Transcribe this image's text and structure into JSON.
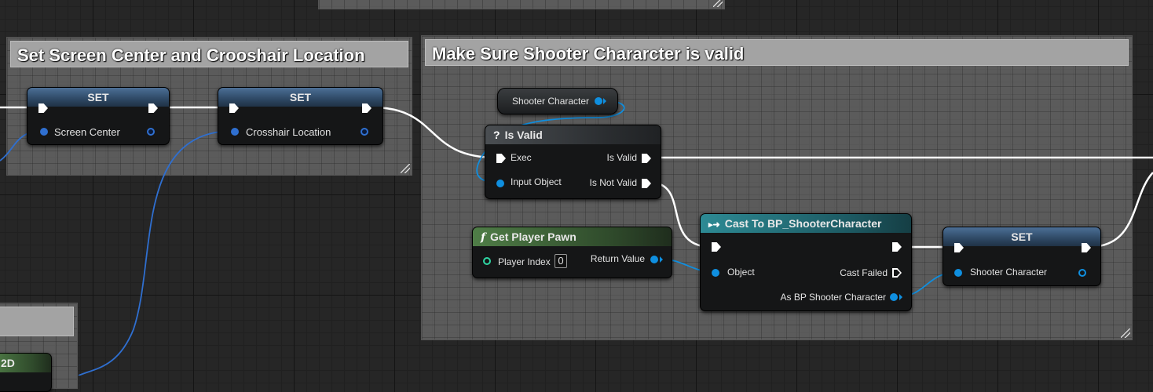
{
  "comments": {
    "top_partial": {
      "title": ""
    },
    "left": {
      "title": "Set Screen Center and Crooshair Location"
    },
    "right": {
      "title": "Make Sure Shooter Chararcter is valid"
    },
    "bottom_left": {
      "title": ""
    }
  },
  "nodes": {
    "set_screen_center": {
      "title": "SET",
      "var_label": "Screen Center"
    },
    "set_crosshair": {
      "title": "SET",
      "var_label": "Crosshair Location"
    },
    "shooter_character_getter": {
      "label": "Shooter Character"
    },
    "is_valid": {
      "title": "Is Valid",
      "exec_label": "Exec",
      "input_label": "Input Object",
      "is_valid_label": "Is Valid",
      "is_not_valid_label": "Is Not Valid"
    },
    "get_player_pawn": {
      "title": "Get Player Pawn",
      "player_index_label": "Player Index",
      "player_index_value": "0",
      "return_label": "Return Value"
    },
    "cast": {
      "title": "Cast To BP_ShooterCharacter",
      "object_label": "Object",
      "cast_failed_label": "Cast Failed",
      "as_label": "As BP Shooter Character"
    },
    "set_shooter": {
      "title": "SET",
      "var_label": "Shooter Character"
    },
    "partial_2d": {
      "title": "2D"
    }
  },
  "colors": {
    "exec_wire": "#ffffff",
    "object_wire": "#0f8fe0",
    "vector_wire": "#2f6fd0",
    "pure_header": "#4f7d47",
    "cast_header": "#2d8a94",
    "set_header": "#4c6f96"
  },
  "icons": {
    "is_valid": "question-mark-icon",
    "get_player_pawn": "function-icon",
    "cast": "cast-arrow-icon"
  }
}
